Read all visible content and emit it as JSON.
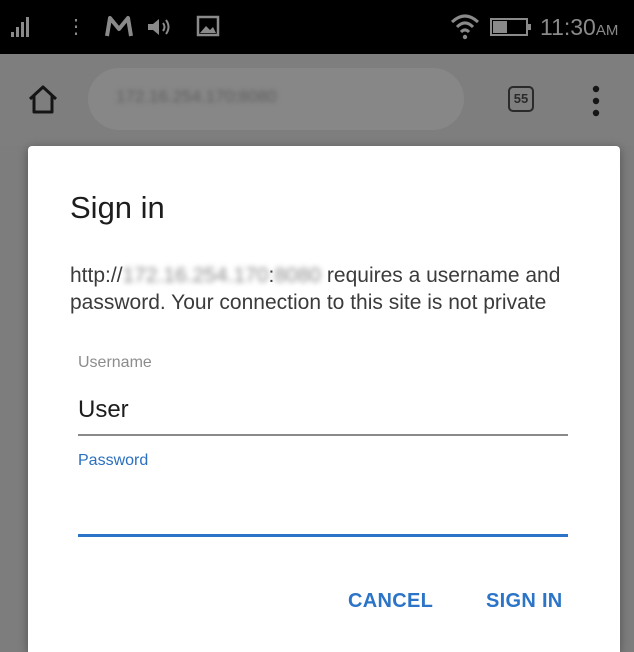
{
  "status_bar": {
    "time": "11:30",
    "ampm": "AM",
    "menu_dots": "⋮",
    "icons": [
      "signal-icon",
      "m-logo-icon",
      "volume-icon",
      "image-icon",
      "wifi-icon",
      "battery-icon"
    ]
  },
  "browser": {
    "url_host": "172.16.254.170",
    "url_sep": ":",
    "url_port": "8080",
    "tab_count": "55",
    "icons": [
      "home-icon",
      "overflow-menu-icon"
    ]
  },
  "dialog": {
    "title": "Sign in",
    "message_prefix": "http://",
    "message_host": "172.16.254.170",
    "message_sep": ":",
    "message_port": "8080",
    "message_suffix": " requires a username and password. Your connection to this site is not private",
    "username_label": "Username",
    "username_value": "User",
    "password_label": "Password",
    "password_value": "",
    "cancel_label": "CANCEL",
    "signin_label": "SIGN IN"
  },
  "colors": {
    "accent": "#2b74c8",
    "scrim": "#7d7d7d",
    "status_bar": "#000000"
  }
}
